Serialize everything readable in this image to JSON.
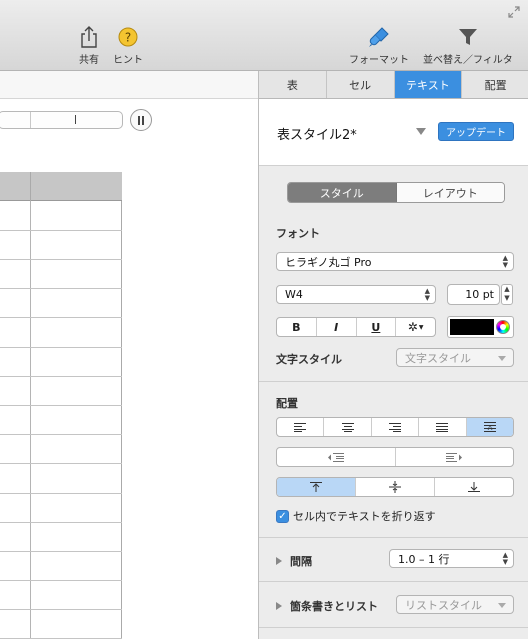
{
  "toolbar": {
    "share_label": "共有",
    "hint_label": "ヒント",
    "format_label": "フォーマット",
    "sort_filter_label": "並べ替え／フィルタ"
  },
  "inspector": {
    "tabs": [
      "表",
      "セル",
      "テキスト",
      "配置"
    ],
    "active_tab": "テキスト",
    "style_name": "表スタイル2*",
    "update_label": "アップデート",
    "segments": [
      "スタイル",
      "レイアウト"
    ],
    "font": {
      "section_label": "フォント",
      "family": "ヒラギノ丸ゴ Pro",
      "weight": "W4",
      "size": "10 pt",
      "bold": "B",
      "italic": "I",
      "underline": "U",
      "color": "#000000"
    },
    "char_style": {
      "label": "文字スタイル",
      "value": "文字スタイル"
    },
    "alignment": {
      "section_label": "配置"
    },
    "wrap_text": {
      "label": "セル内でテキストを折り返す",
      "checked": true
    },
    "spacing": {
      "label": "間隔",
      "value": "1.0 – 1 行"
    },
    "bullets": {
      "label": "箇条書きとリスト",
      "value": "リストスタイル"
    }
  }
}
